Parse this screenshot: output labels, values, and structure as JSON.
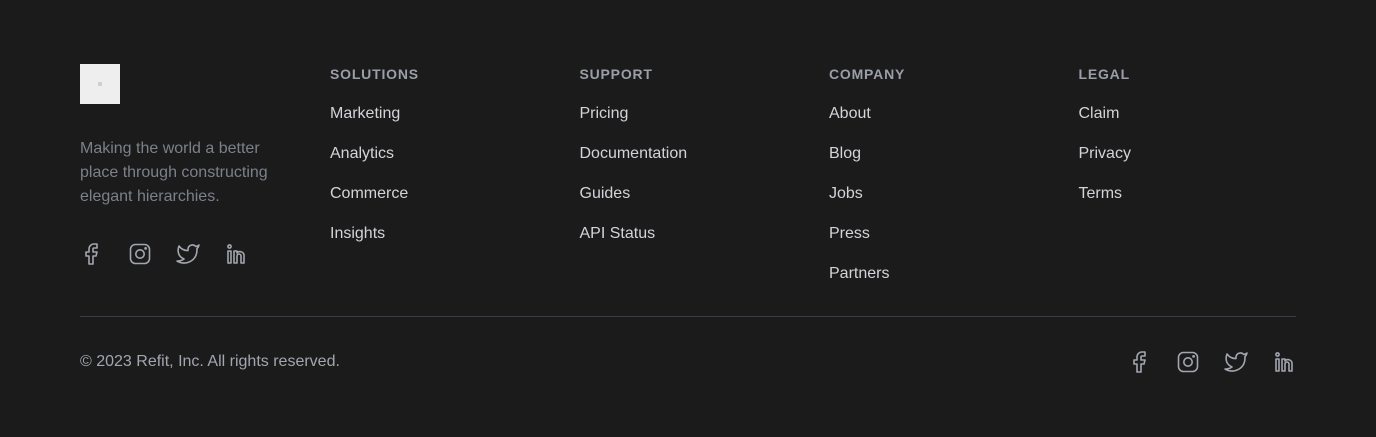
{
  "brand": {
    "tagline": "Making the world a better place through constructing elegant hierarchies."
  },
  "social_icons": [
    "facebook-icon",
    "instagram-icon",
    "twitter-icon",
    "linkedin-icon"
  ],
  "columns": [
    {
      "heading": "SOLUTIONS",
      "links": [
        "Marketing",
        "Analytics",
        "Commerce",
        "Insights"
      ]
    },
    {
      "heading": "SUPPORT",
      "links": [
        "Pricing",
        "Documentation",
        "Guides",
        "API Status"
      ]
    },
    {
      "heading": "COMPANY",
      "links": [
        "About",
        "Blog",
        "Jobs",
        "Press",
        "Partners"
      ]
    },
    {
      "heading": "LEGAL",
      "links": [
        "Claim",
        "Privacy",
        "Terms"
      ]
    }
  ],
  "bottom": {
    "copyright": "© 2023 Refit, Inc. All rights reserved."
  },
  "colors": {
    "background": "#1b1b1c",
    "heading": "#9a9ea6",
    "link": "#d2d4d8",
    "muted": "#7c8089",
    "divider": "#3a3d46"
  }
}
